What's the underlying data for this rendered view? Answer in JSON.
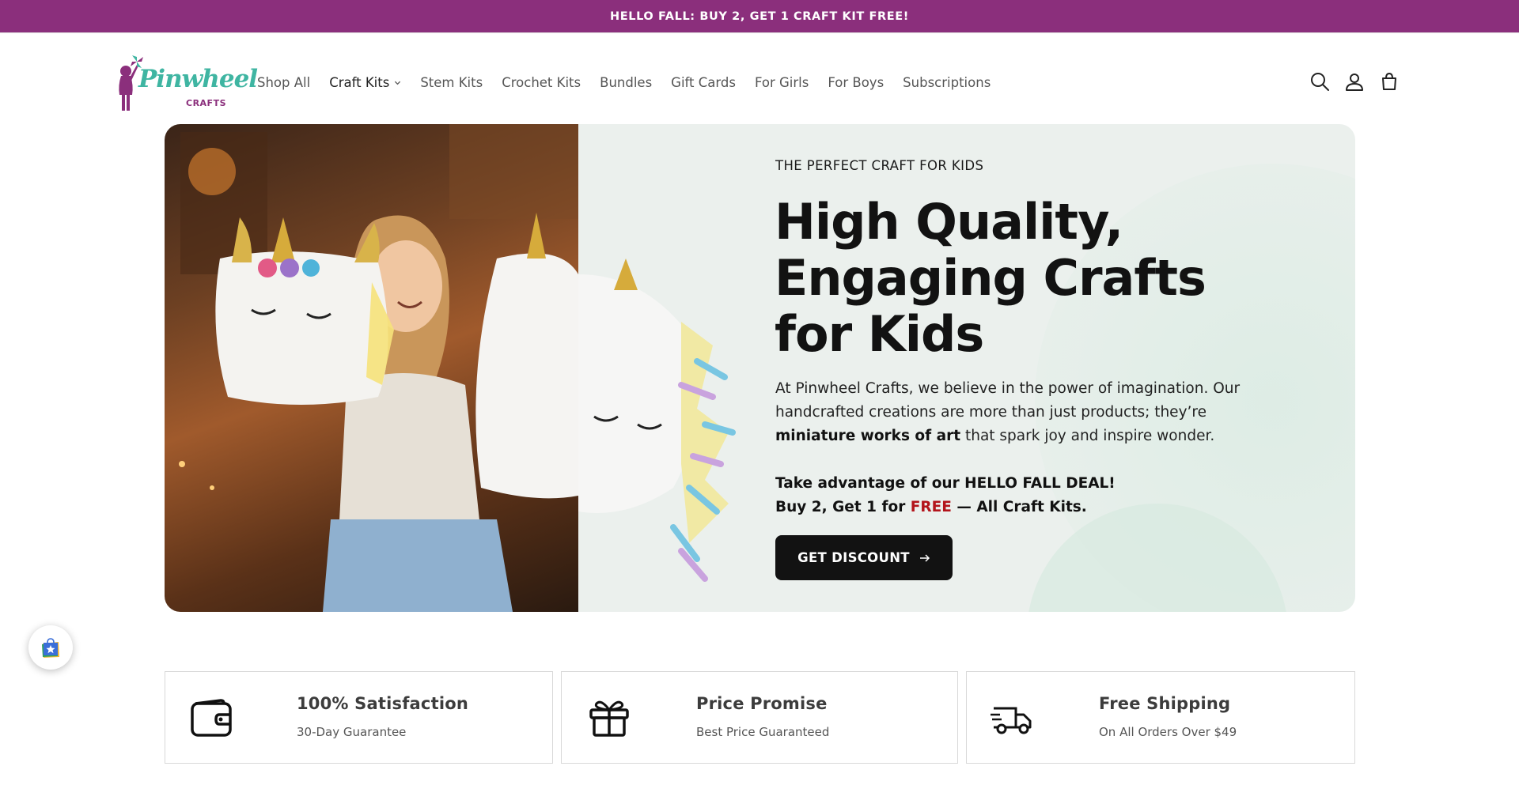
{
  "announcement": {
    "text": "HELLO FALL: BUY 2, GET 1 CRAFT KIT FREE!"
  },
  "brand": {
    "logo_name": "Pinwheel",
    "logo_sub": "CRAFTS",
    "logo_icon": "pinwheel-girl-logo",
    "accent_color": "#8b2f7c",
    "logo_color": "#3fb5a2"
  },
  "nav": {
    "items": [
      {
        "label": "Shop All"
      },
      {
        "label": "Craft Kits",
        "has_dropdown": true,
        "active": true
      },
      {
        "label": "Stem Kits"
      },
      {
        "label": "Crochet Kits"
      },
      {
        "label": "Bundles"
      },
      {
        "label": "Gift Cards"
      },
      {
        "label": "For Girls"
      },
      {
        "label": "For Boys"
      },
      {
        "label": "Subscriptions"
      }
    ]
  },
  "header_icons": [
    "search-icon",
    "account-icon",
    "cart-icon"
  ],
  "hero": {
    "eyebrow": "THE PERFECT CRAFT FOR KIDS",
    "title_lines": [
      "High Quality,",
      "Engaging Crafts",
      "for Kids"
    ],
    "body_part1": "At Pinwheel Crafts, we believe in the power of imagination. Our handcrafted creations are more than just products; they’re ",
    "body_bold": "miniature works of art",
    "body_part2": " that spark joy and inspire wonder.",
    "deal_line1": "Take advantage of our HELLO FALL DEAL!",
    "deal_line2_prefix": "Buy 2, Get 1 for ",
    "deal_free": "FREE",
    "deal_line2_suffix": " — All Craft Kits.",
    "cta_label": "GET DISCOUNT",
    "cta_icon": "arrow-right-icon",
    "free_color": "#b3141b"
  },
  "features": [
    {
      "icon": "wallet-icon",
      "title": "100% Satisfaction",
      "subtitle": "30-Day Guarantee"
    },
    {
      "icon": "gift-icon",
      "title": "Price Promise",
      "subtitle": "Best Price Guaranteed"
    },
    {
      "icon": "truck-icon",
      "title": "Free Shipping",
      "subtitle": "On All Orders Over $49"
    }
  ],
  "rewards_widget": {
    "icon": "rewards-bag-icon"
  }
}
